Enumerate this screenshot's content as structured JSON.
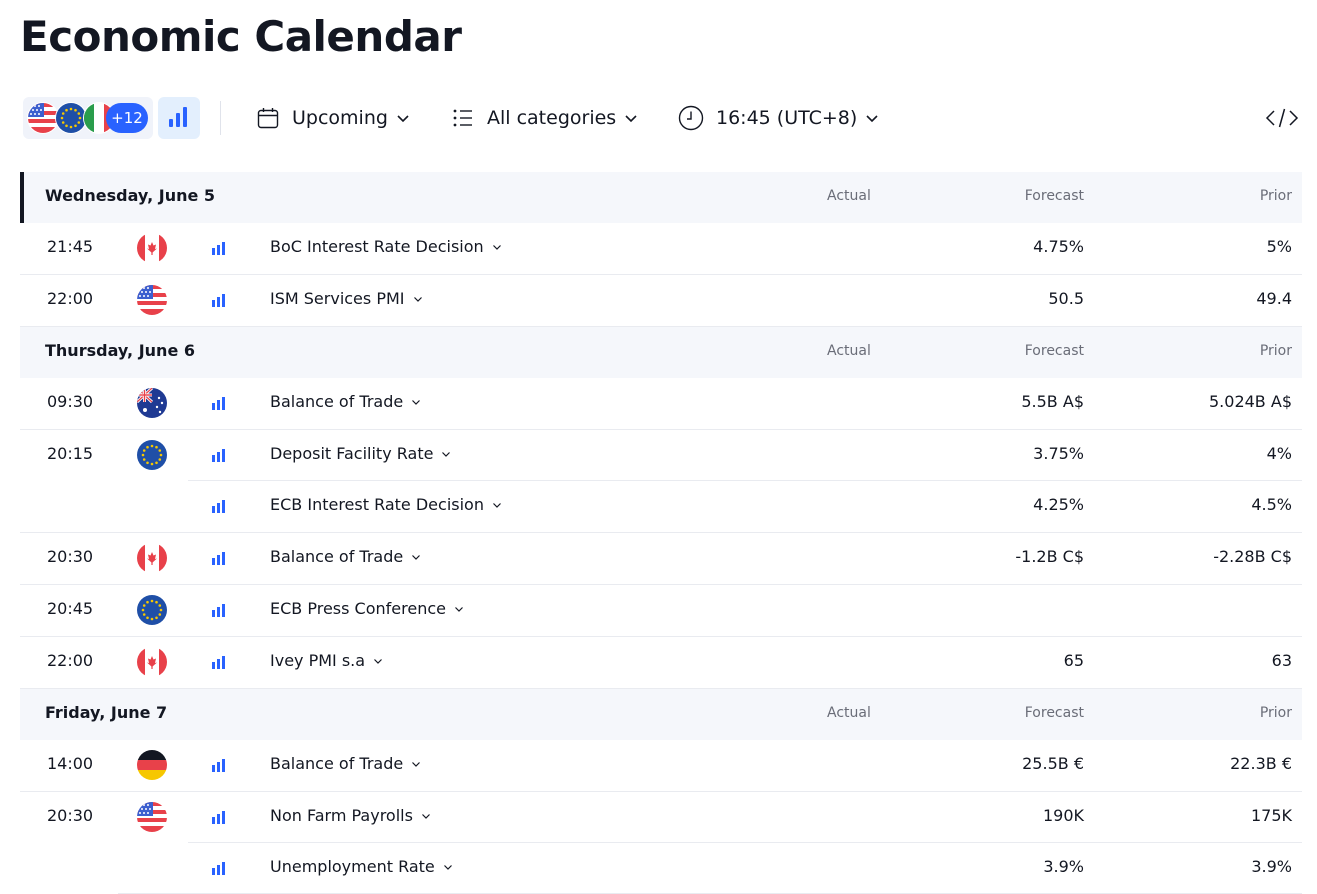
{
  "page": {
    "title": "Economic Calendar"
  },
  "toolbar": {
    "country_flags": [
      "us-flag-icon",
      "eu-flag-icon",
      "it-flag-icon"
    ],
    "more_countries": "+12",
    "period": "Upcoming",
    "categories": "All categories",
    "timezone": "16:45 (UTC+8)"
  },
  "colors": {
    "accent": "#2962ff",
    "importance": "#2962ff"
  },
  "headers": {
    "actual": "Actual",
    "forecast": "Forecast",
    "prior": "Prior"
  },
  "days": [
    {
      "label": "Wednesday, June 5",
      "events": [
        {
          "time": "21:45",
          "country": "ca-flag-icon",
          "name": "BoC Interest Rate Decision",
          "forecast": "4.75%",
          "prior": "5%"
        },
        {
          "time": "22:00",
          "country": "us-flag-icon",
          "name": "ISM Services PMI",
          "forecast": "50.5",
          "prior": "49.4"
        }
      ]
    },
    {
      "label": "Thursday, June 6",
      "events": [
        {
          "time": "09:30",
          "country": "au-flag-icon",
          "name": "Balance of Trade",
          "forecast": "5.5B A$",
          "prior": "5.024B A$"
        },
        {
          "time": "20:15",
          "country": "eu-flag-icon",
          "name": "Deposit Facility Rate",
          "forecast": "3.75%",
          "prior": "4%"
        },
        {
          "time": "",
          "country": "",
          "name": "ECB Interest Rate Decision",
          "forecast": "4.25%",
          "prior": "4.5%"
        },
        {
          "time": "20:30",
          "country": "ca-flag-icon",
          "name": "Balance of Trade",
          "forecast": "-1.2B C$",
          "prior": "-2.28B C$"
        },
        {
          "time": "20:45",
          "country": "eu-flag-icon",
          "name": "ECB Press Conference",
          "forecast": "",
          "prior": ""
        },
        {
          "time": "22:00",
          "country": "ca-flag-icon",
          "name": "Ivey PMI s.a",
          "forecast": "65",
          "prior": "63"
        }
      ]
    },
    {
      "label": "Friday, June 7",
      "events": [
        {
          "time": "14:00",
          "country": "de-flag-icon",
          "name": "Balance of Trade",
          "forecast": "25.5B €",
          "prior": "22.3B €"
        },
        {
          "time": "20:30",
          "country": "us-flag-icon",
          "name": "Non Farm Payrolls",
          "forecast": "190K",
          "prior": "175K"
        },
        {
          "time": "",
          "country": "",
          "name": "Unemployment Rate",
          "forecast": "3.9%",
          "prior": "3.9%"
        }
      ]
    }
  ]
}
